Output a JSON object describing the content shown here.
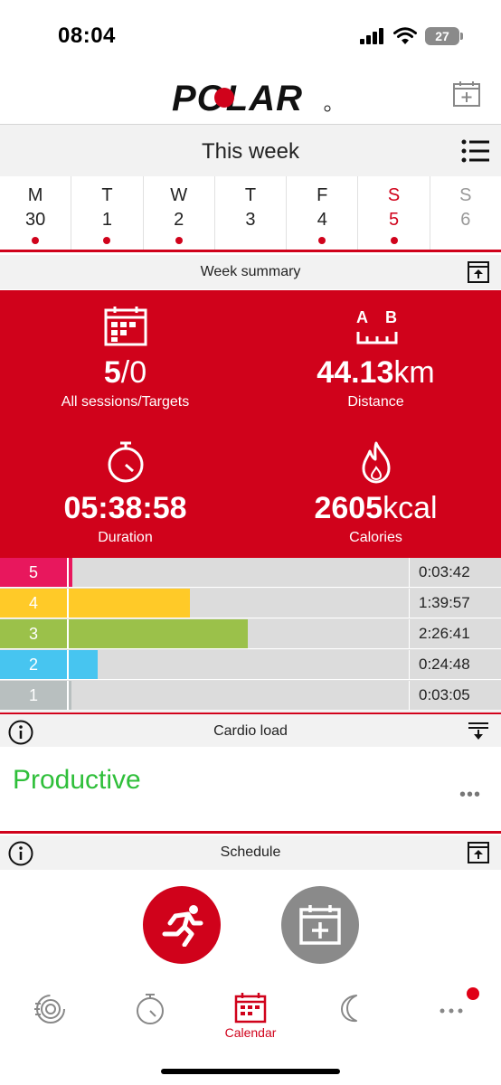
{
  "status_bar": {
    "time": "08:04",
    "battery": "27"
  },
  "header": {
    "brand": "POLAR",
    "add_to_calendar_icon": "calendar-plus-icon"
  },
  "week": {
    "title": "This week",
    "days": [
      {
        "letter": "M",
        "number": "30",
        "has_session": true
      },
      {
        "letter": "T",
        "number": "1",
        "has_session": true
      },
      {
        "letter": "W",
        "number": "2",
        "has_session": true
      },
      {
        "letter": "T",
        "number": "3",
        "has_session": false
      },
      {
        "letter": "F",
        "number": "4",
        "has_session": true
      },
      {
        "letter": "S",
        "number": "5",
        "has_session": true
      },
      {
        "letter": "S",
        "number": "6",
        "has_session": false
      }
    ]
  },
  "week_summary": {
    "title": "Week summary",
    "sessions": {
      "value_bold": "5",
      "value_rest": "/0",
      "label": "All sessions/Targets"
    },
    "distance": {
      "value_bold": "44.13",
      "value_rest": "km",
      "label": "Distance",
      "icon_a": "A",
      "icon_b": "B"
    },
    "duration": {
      "value_bold": "05:38:58",
      "label": "Duration"
    },
    "calories": {
      "value_bold": "2605",
      "value_rest": "kcal",
      "label": "Calories"
    }
  },
  "zones": [
    {
      "zone": "5",
      "time": "0:03:42",
      "fraction": 0.017,
      "color": "#e8175d"
    },
    {
      "zone": "4",
      "time": "1:39:57",
      "fraction": 0.36,
      "color": "#ffca28"
    },
    {
      "zone": "3",
      "time": "2:26:41",
      "fraction": 0.53,
      "color": "#9bc14a"
    },
    {
      "zone": "2",
      "time": "0:24:48",
      "fraction": 0.09,
      "color": "#47c5f0"
    },
    {
      "zone": "1",
      "time": "0:03:05",
      "fraction": 0.014,
      "color": "#b8bfbf"
    }
  ],
  "cardio_load": {
    "title": "Cardio load",
    "status": "Productive",
    "status_color": "#2fbf3a",
    "more": "•••"
  },
  "schedule": {
    "title": "Schedule"
  },
  "bottom_nav": {
    "items": [
      {
        "name": "activity",
        "label": ""
      },
      {
        "name": "training",
        "label": ""
      },
      {
        "name": "calendar",
        "label": "Calendar"
      },
      {
        "name": "sleep",
        "label": ""
      },
      {
        "name": "more",
        "label": ""
      }
    ]
  },
  "colors": {
    "accent": "#d0021b",
    "gray_button": "#8a8a8a"
  }
}
